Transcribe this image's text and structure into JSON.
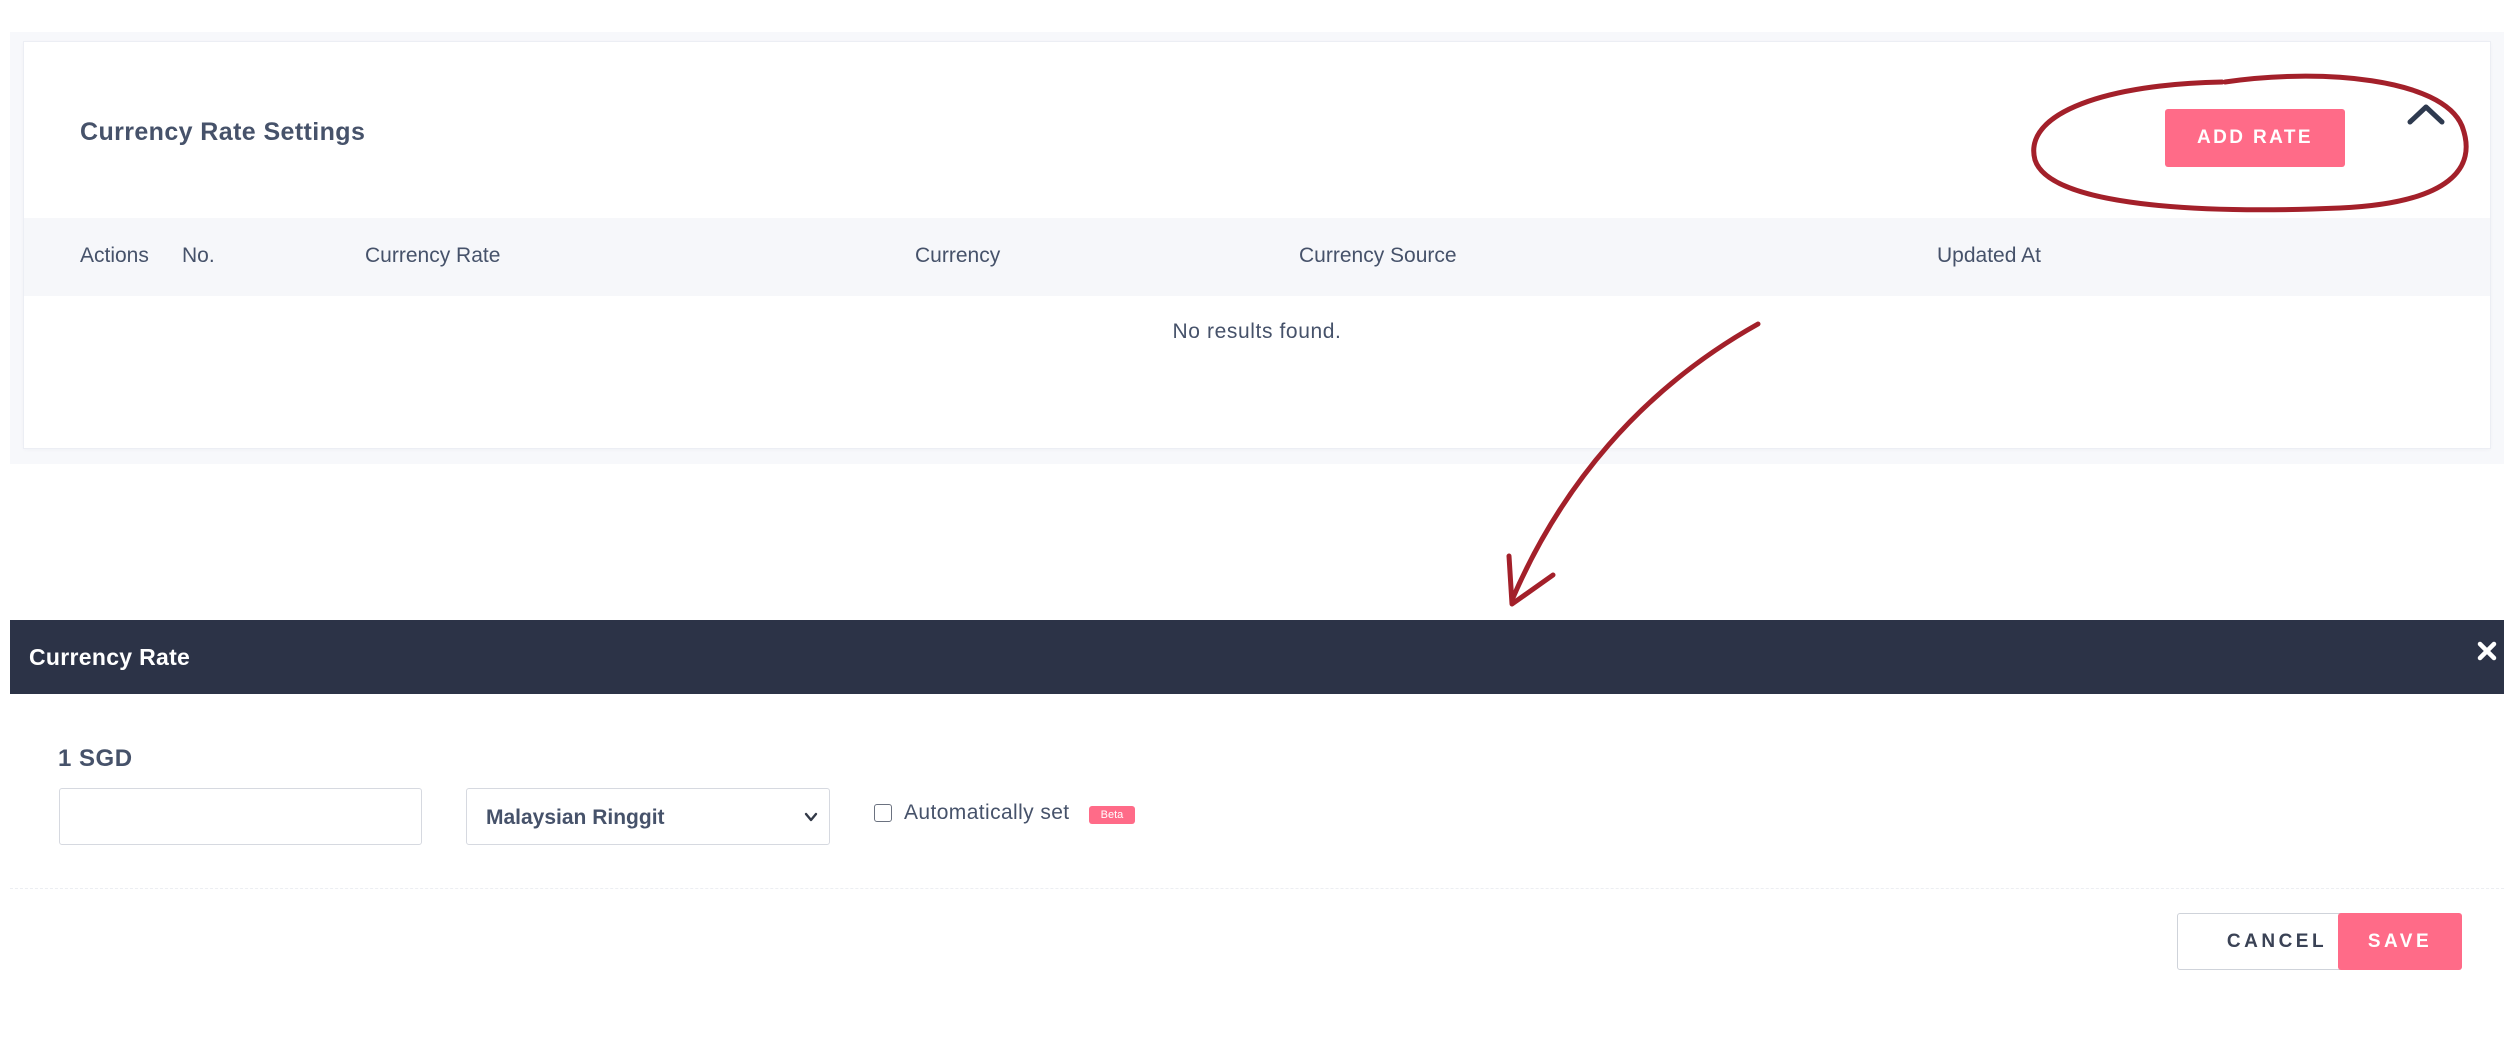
{
  "settings_card": {
    "title": "Currency Rate Settings",
    "add_rate_label": "ADD RATE",
    "collapse_icon": "chevron-up-icon",
    "columns": [
      "Actions",
      "No.",
      "Currency Rate",
      "Currency",
      "Currency Source",
      "Updated At"
    ],
    "empty_text": "No results found."
  },
  "annotation": {
    "color": "#a3202a"
  },
  "modal": {
    "title": "Currency Rate",
    "close_icon": "close-icon",
    "base_label": "1 SGD",
    "rate_input_value": "",
    "currency_selected": "Malaysian Ringgit",
    "auto_set_label": "Automatically set",
    "auto_set_checked": false,
    "beta_badge": "Beta",
    "cancel_label": "CANCEL",
    "save_label": "SAVE"
  },
  "colors": {
    "accent": "#ff6b88",
    "header_bg": "#2c3347",
    "text": "#46526a"
  }
}
